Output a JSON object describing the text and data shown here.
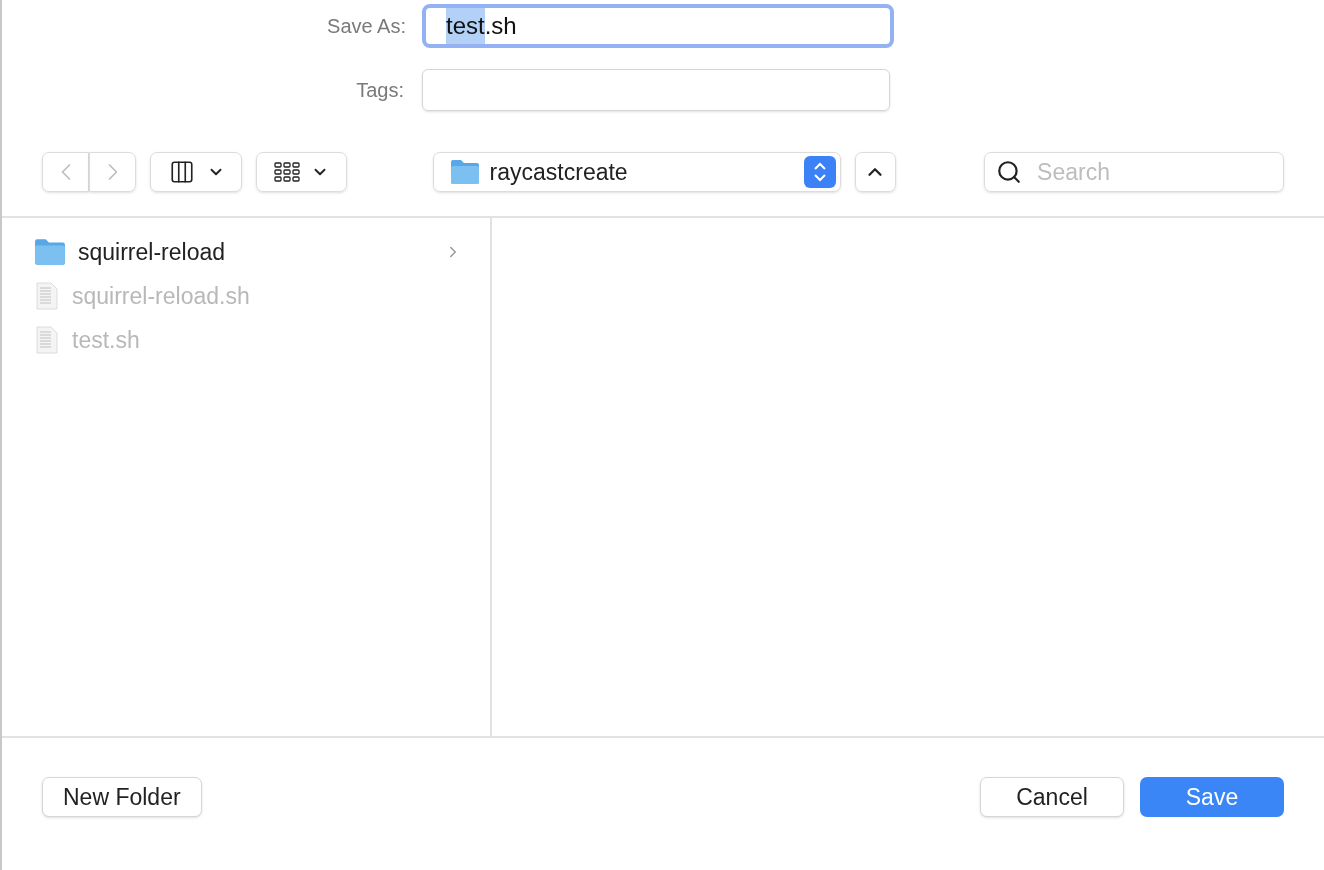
{
  "save_as": {
    "label": "Save As:",
    "value_parts": [
      {
        "text": "test",
        "selected": true
      },
      {
        "text": ".sh",
        "selected": false
      }
    ],
    "focused": true
  },
  "tags": {
    "label": "Tags:"
  },
  "toolbar": {
    "back_disabled": true,
    "forward_disabled": true,
    "location": "raycastcreate",
    "search": {
      "placeholder": "Search"
    }
  },
  "files": [
    {
      "name": "squirrel-reload",
      "kind": "folder",
      "disabled": false
    },
    {
      "name": "squirrel-reload.sh",
      "kind": "file",
      "disabled": true
    },
    {
      "name": "test.sh",
      "kind": "file",
      "disabled": true
    }
  ],
  "buttons": [
    {
      "label": "New Folder",
      "kind": "secondary"
    },
    {
      "label": "Cancel",
      "kind": "secondary"
    },
    {
      "label": "Save",
      "kind": "primary"
    }
  ]
}
